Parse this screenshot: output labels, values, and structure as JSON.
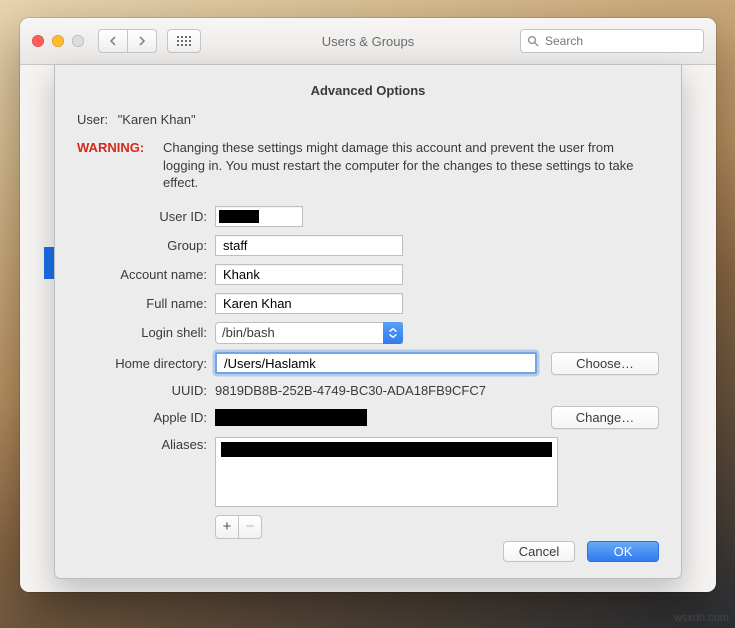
{
  "window": {
    "title": "Users & Groups",
    "search_placeholder": "Search"
  },
  "sheet": {
    "title": "Advanced Options",
    "user_label": "User:",
    "user_value": "\"Karen Khan\"",
    "warning_label": "WARNING:",
    "warning_text": "Changing these settings might damage this account and prevent the user from logging in. You must restart the computer for the changes to these settings to take effect.",
    "labels": {
      "user_id": "User ID:",
      "group": "Group:",
      "account_name": "Account name:",
      "full_name": "Full name:",
      "login_shell": "Login shell:",
      "home_dir": "Home directory:",
      "uuid": "UUID:",
      "apple_id": "Apple ID:",
      "aliases": "Aliases:"
    },
    "values": {
      "user_id": "",
      "group": "staff",
      "account_name": "Khank",
      "full_name": "Karen Khan",
      "login_shell": "/bin/bash",
      "home_dir": "/Users/Haslamk",
      "uuid": "9819DB8B-252B-4749-BC30-ADA18FB9CFC7",
      "apple_id": ""
    },
    "buttons": {
      "choose": "Choose…",
      "change": "Change…",
      "add": "+",
      "remove": "−",
      "cancel": "Cancel",
      "ok": "OK"
    }
  },
  "watermark": "wsxdn.com"
}
